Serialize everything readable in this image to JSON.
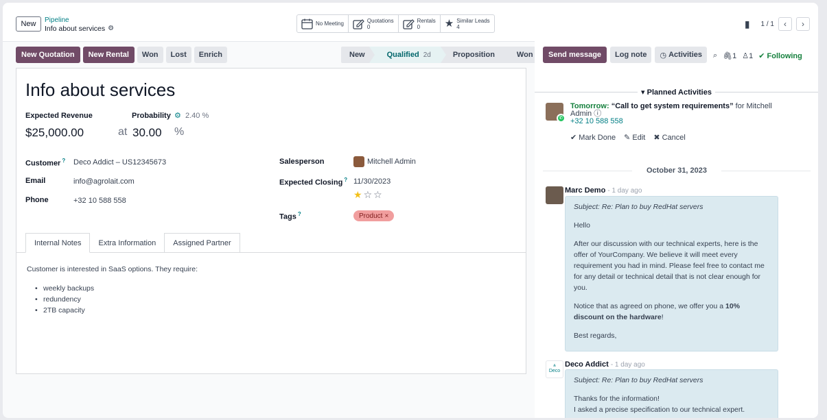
{
  "topbar": {
    "new_label": "New",
    "breadcrumb_parent": "Pipeline",
    "breadcrumb_current": "Info about services",
    "smart_buttons": [
      {
        "title": "No Meeting",
        "count": "",
        "icon": "calendar-icon"
      },
      {
        "title": "Quotations",
        "count": "0",
        "icon": "edit-icon"
      },
      {
        "title": "Rentals",
        "count": "0",
        "icon": "edit-icon"
      },
      {
        "title": "Similar Leads",
        "count": "4",
        "icon": "star-icon"
      }
    ],
    "pager": "1 / 1"
  },
  "actions": {
    "new_quotation": "New Quotation",
    "new_rental": "New Rental",
    "won": "Won",
    "lost": "Lost",
    "enrich": "Enrich"
  },
  "stages": [
    {
      "label": "New"
    },
    {
      "label": "Qualified",
      "days": "2d"
    },
    {
      "label": "Proposition"
    },
    {
      "label": "Won"
    }
  ],
  "form": {
    "title": "Info about services",
    "expected_revenue_label": "Expected Revenue",
    "probability_label": "Probability",
    "probability_value": "2.40 %",
    "revenue": "$25,000.00",
    "at_label": "at",
    "probability": "30.00",
    "pct": "%",
    "customer_label": "Customer",
    "customer": "Deco Addict – US12345673",
    "email_label": "Email",
    "email": "info@agrolait.com",
    "phone_label": "Phone",
    "phone": "+32 10 588 558",
    "salesperson_label": "Salesperson",
    "salesperson": "Mitchell Admin",
    "closing_label": "Expected Closing",
    "closing": "11/30/2023",
    "priority_stars": 1,
    "tags_label": "Tags",
    "tag": "Product",
    "tabs": [
      "Internal Notes",
      "Extra Information",
      "Assigned Partner"
    ],
    "notes_intro": "Customer is interested in SaaS options. They require:",
    "notes_items": [
      "weekly backups",
      "redundency",
      "2TB capacity"
    ]
  },
  "chatter": {
    "send_message": "Send message",
    "log_note": "Log note",
    "activities": "Activities",
    "attachments": "1",
    "followers": "1",
    "following": "Following",
    "planned_header": "Planned Activities",
    "activity_when": "Tomorrow:",
    "activity_title": "“Call to get system requirements”",
    "activity_for": "for Mitchell Admin",
    "activity_phone": "+32 10 588 558",
    "mark_done": "Mark Done",
    "edit": "Edit",
    "cancel": "Cancel",
    "date_sep": "October 31, 2023",
    "messages": [
      {
        "author": "Marc Demo",
        "ago": "- 1 day ago",
        "subject": "Subject: Re: Plan to buy RedHat servers",
        "hello": "Hello",
        "p1": "After our discussion with our technical experts, here is the offer of YourCompany. We believe it will meet every requirement you had in mind. Please feel free to contact me for any detail or technical detail that is not clear enough for you.",
        "p2a": "Notice that as agreed on phone, we offer you a ",
        "p2b": "10% discount on the hardware",
        "p2c": "!",
        "p3": "Best regards,"
      },
      {
        "author": "Deco Addict",
        "ago": "- 1 day ago",
        "subject": "Subject: Re: Plan to buy RedHat servers",
        "l1": "Thanks for the information!",
        "l2": "I asked a precise specification to our technical expert."
      }
    ],
    "deco_logo_text": "Deco"
  }
}
